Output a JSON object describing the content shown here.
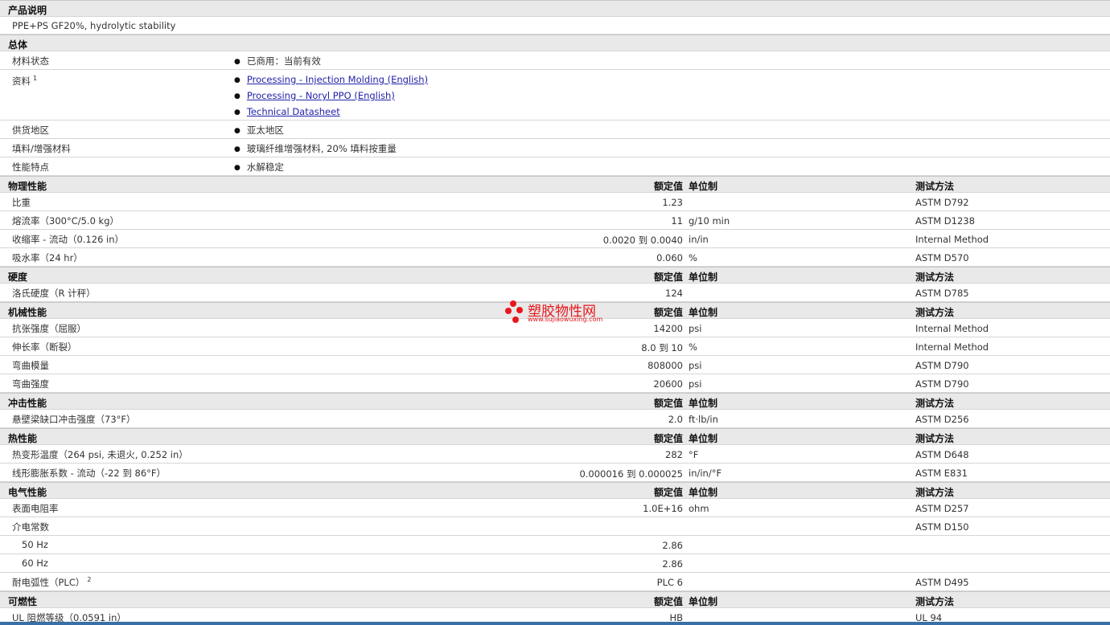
{
  "sections": {
    "desc": {
      "title": "产品说明",
      "text": "PPE+PS GF20%, hydrolytic stability"
    },
    "general": {
      "title": "总体",
      "status_label": "材料状态",
      "status_value": "已商用：当前有效",
      "docs_label": "资料",
      "docs_sup": "1",
      "docs": [
        "Processing - Injection Molding (English)",
        "Processing - Noryl PPO (English)",
        "Technical Datasheet"
      ],
      "region_label": "供货地区",
      "region_value": "亚太地区",
      "filler_label": "填料/增强材料",
      "filler_value": "玻璃纤维增强材料, 20% 填料按重量",
      "feature_label": "性能特点",
      "feature_value": "水解稳定"
    },
    "cols": {
      "val": "额定值",
      "unit": "单位制",
      "test": "测试方法"
    },
    "physical": {
      "title": "物理性能",
      "rows": [
        {
          "d": "比重",
          "v": "1.23",
          "u": "",
          "t": "ASTM D792"
        },
        {
          "d": "熔流率（300°C/5.0 kg）",
          "v": "11",
          "u": "g/10 min",
          "t": "ASTM D1238"
        },
        {
          "d": "收缩率 - 流动（0.126 in）",
          "v": "0.0020 到  0.0040",
          "u": "in/in",
          "t": "Internal Method"
        },
        {
          "d": "吸水率（24 hr）",
          "v": "0.060",
          "u": "%",
          "t": "ASTM D570"
        }
      ]
    },
    "hardness": {
      "title": "硬度",
      "rows": [
        {
          "d": "洛氏硬度（R 计秤）",
          "v": "124",
          "u": "",
          "t": "ASTM D785"
        }
      ]
    },
    "mechanical": {
      "title": "机械性能",
      "rows": [
        {
          "d": "抗张强度（屈服）",
          "v": "14200",
          "u": "psi",
          "t": "Internal Method"
        },
        {
          "d": "伸长率（断裂）",
          "v": "8.0 到  10",
          "u": "%",
          "t": "Internal Method"
        },
        {
          "d": "弯曲模量",
          "v": "808000",
          "u": "psi",
          "t": "ASTM D790"
        },
        {
          "d": "弯曲强度",
          "v": "20600",
          "u": "psi",
          "t": "ASTM D790"
        }
      ]
    },
    "impact": {
      "title": "冲击性能",
      "rows": [
        {
          "d": "悬壁梁缺口冲击强度（73°F）",
          "v": "2.0",
          "u": "ft·lb/in",
          "t": "ASTM D256"
        }
      ]
    },
    "thermal": {
      "title": "热性能",
      "rows": [
        {
          "d": "热变形温度（264 psi, 未退火, 0.252 in）",
          "v": "282",
          "u": "°F",
          "t": "ASTM D648"
        },
        {
          "d": "线形膨胀系数 - 流动（-22 到  86°F）",
          "v": "0.000016 到  0.000025",
          "u": "in/in/°F",
          "t": "ASTM E831"
        }
      ]
    },
    "electrical": {
      "title": "电气性能",
      "rows": [
        {
          "d": "表面电阻率",
          "v": "1.0E+16",
          "u": "ohm",
          "t": "ASTM D257"
        },
        {
          "d": "介电常数",
          "v": "",
          "u": "",
          "t": "ASTM D150"
        },
        {
          "d": "50 Hz",
          "v": "2.86",
          "u": "",
          "t": ""
        },
        {
          "d": "60 Hz",
          "v": "2.86",
          "u": "",
          "t": ""
        }
      ],
      "arc_label": "耐电弧性（PLC）",
      "arc_sup": "2",
      "arc_value": "PLC 6",
      "arc_test": "ASTM D495"
    },
    "flammability": {
      "title": "可燃性",
      "rows": [
        {
          "d": "UL 阻燃等级（0.0591 in）",
          "v": "HB",
          "u": "",
          "t": "UL 94"
        }
      ]
    }
  },
  "watermark": {
    "name": "塑胶物性网",
    "url": "www.sujiaowuxing.com",
    "color": "#e8161b"
  }
}
